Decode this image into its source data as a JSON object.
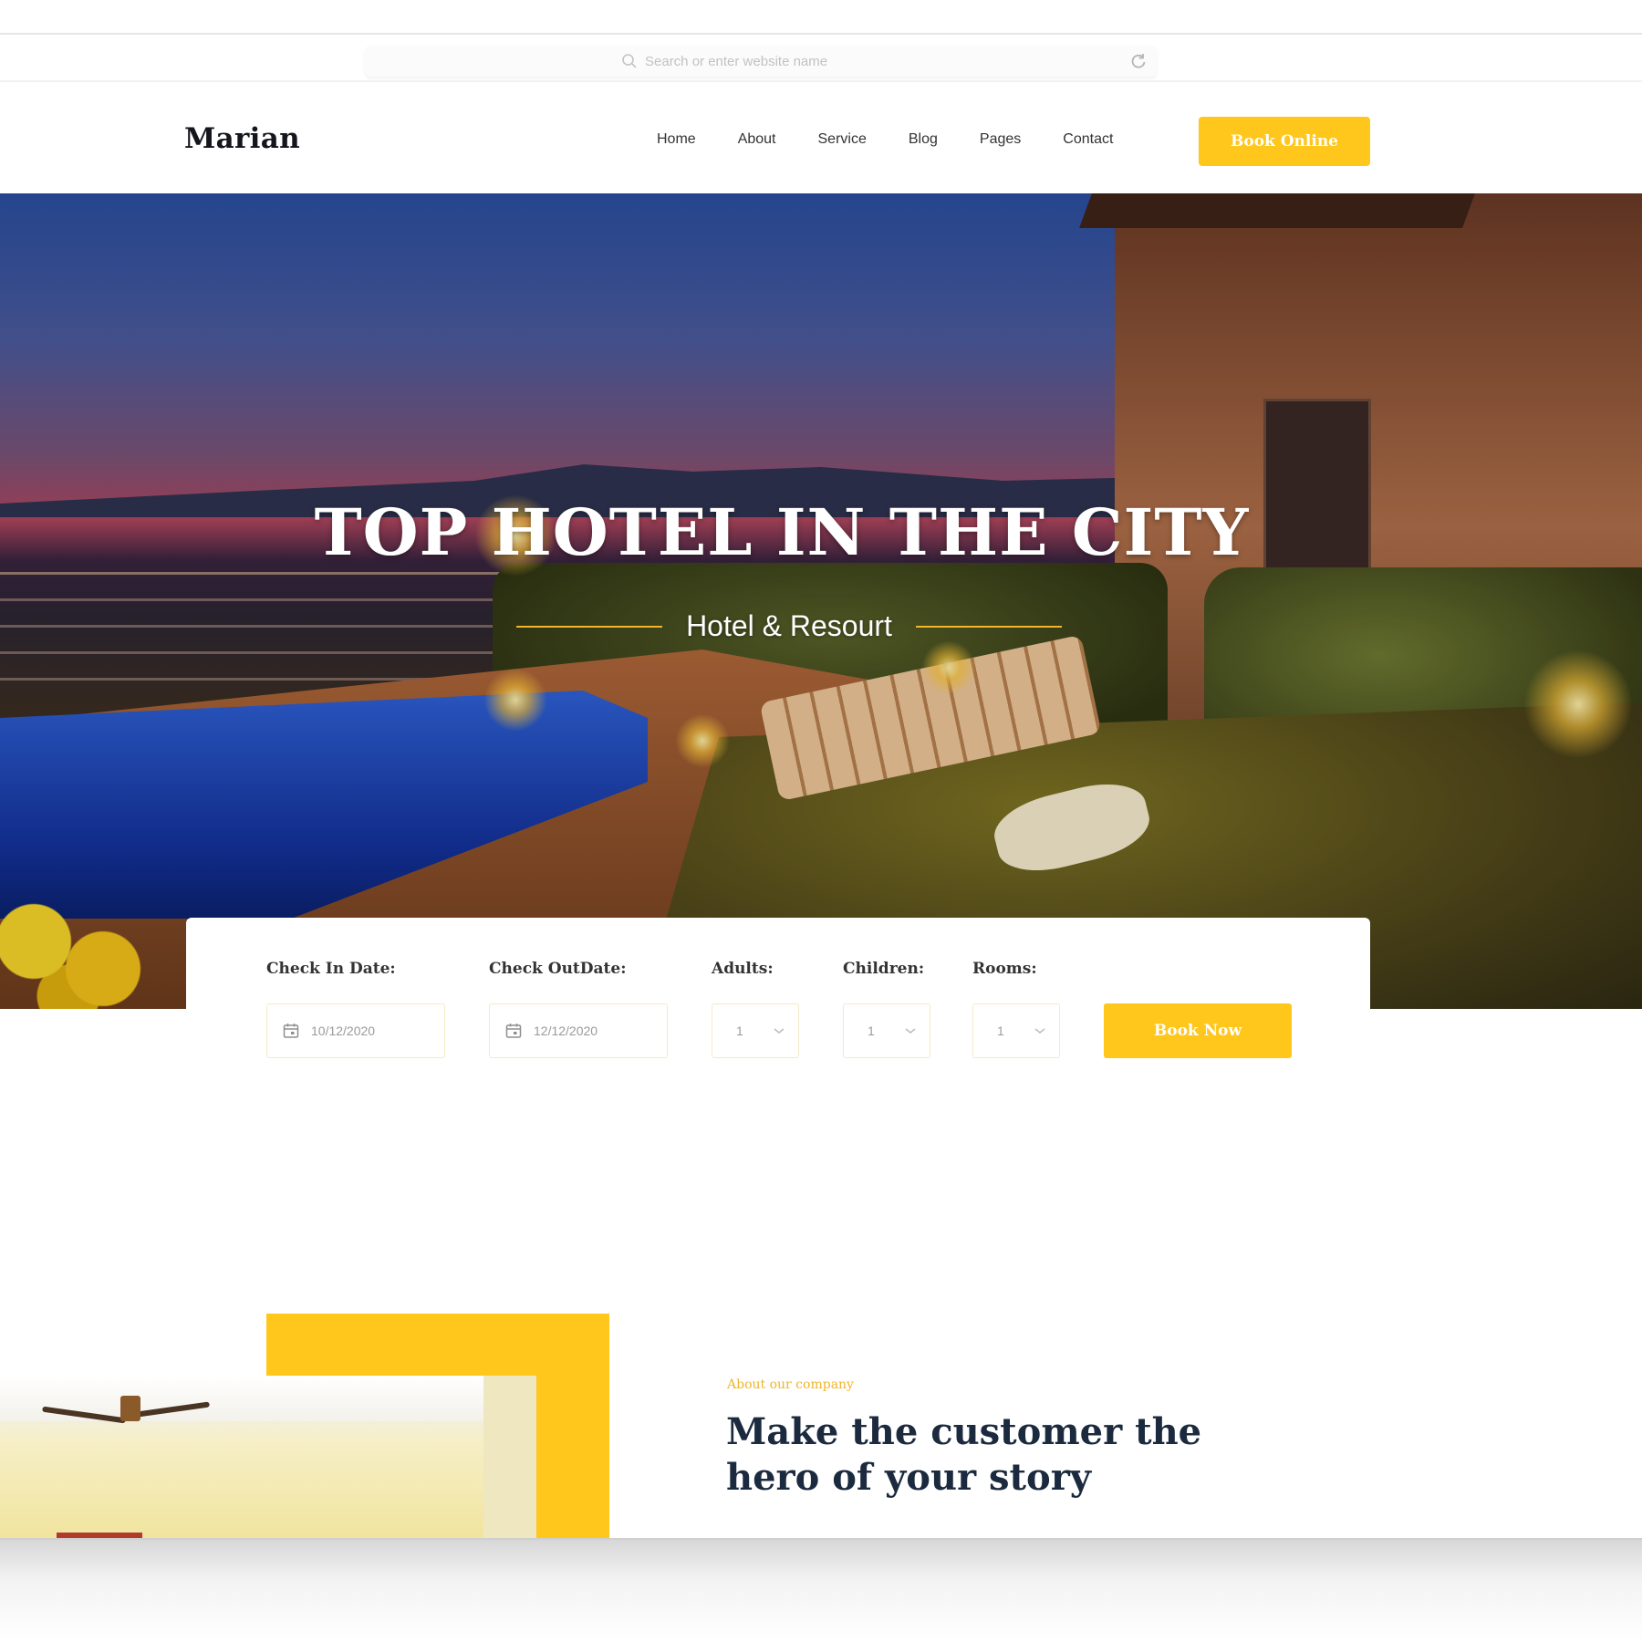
{
  "browser": {
    "search_placeholder": "Search or enter website name",
    "icons": {
      "search": "search-icon",
      "reload": "reload-icon"
    }
  },
  "header": {
    "logo": "Marian",
    "nav": [
      "Home",
      "About",
      "Service",
      "Blog",
      "Pages",
      "Contact"
    ],
    "cta_label": "Book Online"
  },
  "hero": {
    "title": "TOP HOTEL IN THE CITY",
    "subtitle": "Hotel & Resourt",
    "slides_count": 3,
    "active_slide": 1
  },
  "booking": {
    "check_in": {
      "label": "Check In Date:",
      "value": "10/12/2020"
    },
    "check_out": {
      "label": "Check OutDate:",
      "value": "12/12/2020"
    },
    "adults": {
      "label": "Adults:",
      "value": "1"
    },
    "children": {
      "label": "Children:",
      "value": "1"
    },
    "rooms": {
      "label": "Rooms:",
      "value": "1"
    },
    "button_label": "Book Now"
  },
  "about": {
    "eyebrow": "About our company",
    "heading_line1": "Make the customer the",
    "heading_line2": "hero of your story"
  },
  "colors": {
    "accent": "#ffc61c",
    "heading": "#1b2a3e",
    "eyebrow": "#f0b52a"
  }
}
